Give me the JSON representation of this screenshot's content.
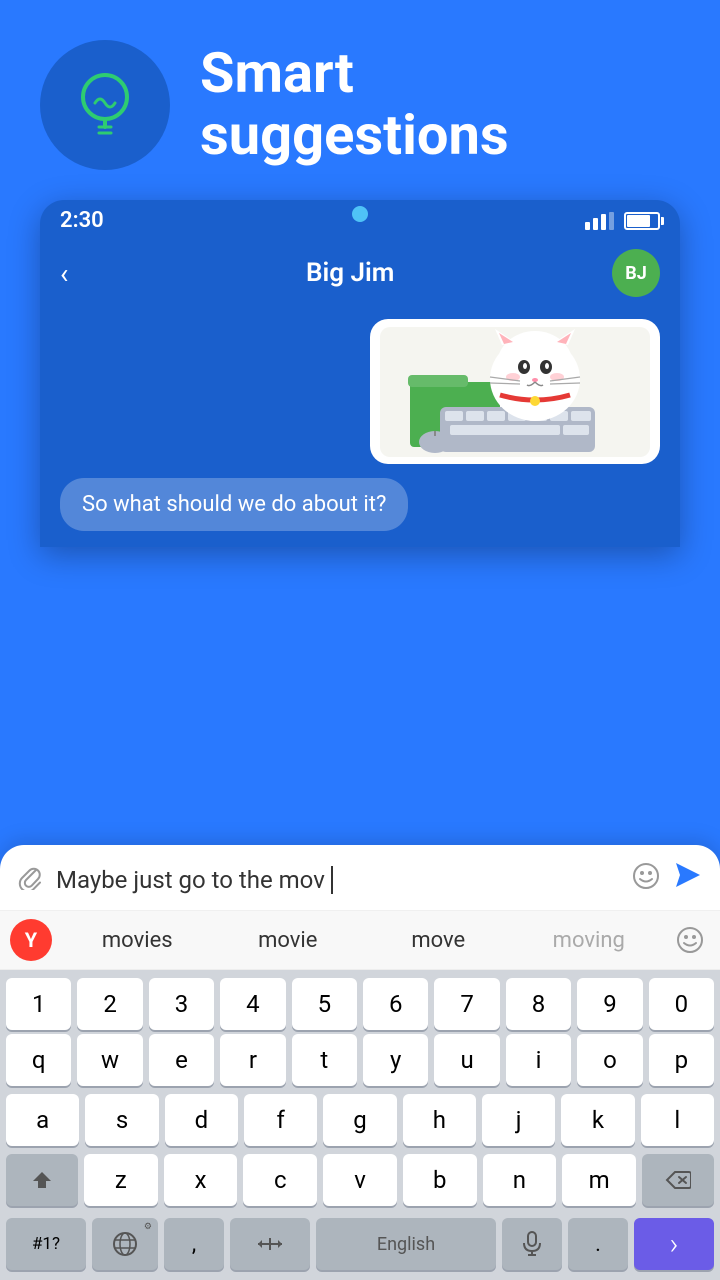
{
  "header": {
    "title_line1": "Smart",
    "title_line2": "suggestions",
    "bulb_icon": "💡"
  },
  "status_bar": {
    "time": "2:30",
    "signal": "signal-icon",
    "battery": "battery-icon"
  },
  "chat": {
    "contact_name": "Big Jim",
    "avatar_initials": "BJ",
    "message_incoming": "So what should we do about it?"
  },
  "input": {
    "text_value": "Maybe just go to the mov",
    "attach_icon": "📎",
    "emoji_icon": "😊",
    "send_icon": "➤"
  },
  "suggestions": {
    "yandex_label": "Y",
    "items": [
      "movies",
      "movie",
      "move",
      "moving"
    ],
    "emoji_icon": "😊"
  },
  "keyboard": {
    "number_row": [
      "1",
      "2",
      "3",
      "4",
      "5",
      "6",
      "7",
      "8",
      "9",
      "0"
    ],
    "row1": [
      "q",
      "w",
      "e",
      "r",
      "t",
      "y",
      "u",
      "i",
      "o",
      "p"
    ],
    "row2": [
      "a",
      "s",
      "d",
      "f",
      "g",
      "h",
      "j",
      "k",
      "l"
    ],
    "row3": [
      "z",
      "x",
      "c",
      "v",
      "b",
      "n",
      "m"
    ],
    "shift_icon": "⇧",
    "backspace_icon": "⌫",
    "num_sym_label": "#1?",
    "globe_icon": "🌐",
    "comma_label": ",",
    "move_icon": "⇔",
    "language_label": "English",
    "mic_icon": "🎙",
    "period_label": ".",
    "next_icon": "›"
  },
  "colors": {
    "bg_blue": "#2979FF",
    "keyboard_bg": "#d1d5db",
    "accent_purple": "#6B5CE7",
    "yandex_red": "#FF3B30"
  }
}
